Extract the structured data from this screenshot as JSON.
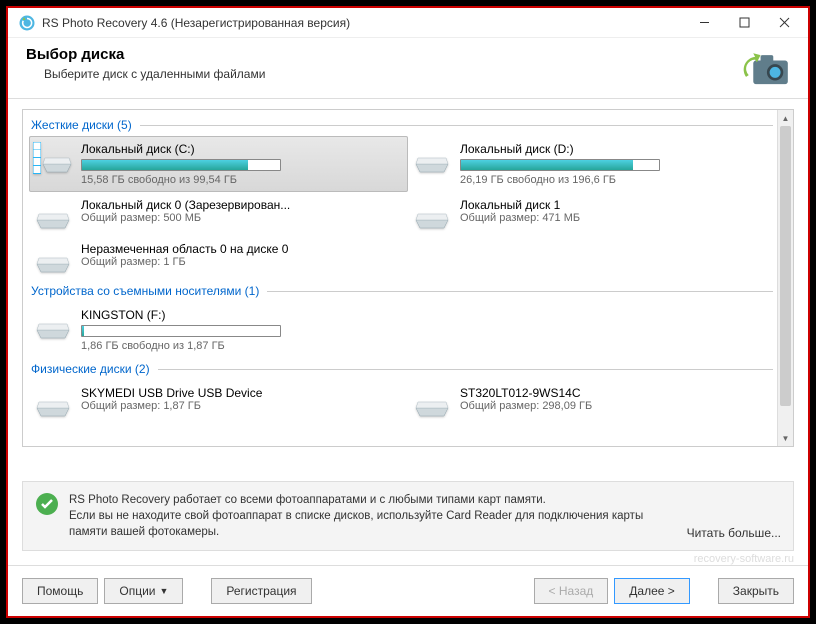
{
  "window": {
    "title": "RS Photo Recovery 4.6 (Незарегистрированная версия)"
  },
  "header": {
    "title": "Выбор диска",
    "subtitle": "Выберите диск с удаленными файлами"
  },
  "sections": {
    "hard": {
      "label": "Жесткие диски (5)"
    },
    "removable": {
      "label": "Устройства со съемными носителями (1)"
    },
    "physical": {
      "label": "Физические диски (2)"
    }
  },
  "disks": {
    "c": {
      "name": "Локальный диск (C:)",
      "sub": "15,58 ГБ свободно из 99,54 ГБ",
      "fill": 84
    },
    "d": {
      "name": "Локальный диск (D:)",
      "sub": "26,19 ГБ свободно из 196,6 ГБ",
      "fill": 87
    },
    "l0": {
      "name": "Локальный диск 0 (Зарезервирован...",
      "sub": "Общий размер: 500 МБ"
    },
    "l1": {
      "name": "Локальный диск 1",
      "sub": "Общий размер: 471 МБ"
    },
    "un": {
      "name": "Неразмеченная область 0 на диске 0",
      "sub": "Общий размер: 1 ГБ"
    },
    "k": {
      "name": "KINGSTON (F:)",
      "sub": "1,86 ГБ свободно из 1,87 ГБ",
      "fill": 1
    },
    "sky": {
      "name": "SKYMEDI USB Drive USB Device",
      "sub": "Общий размер: 1,87 ГБ"
    },
    "st": {
      "name": "ST320LT012-9WS14C",
      "sub": "Общий размер: 298,09 ГБ"
    }
  },
  "info": {
    "text": "RS Photo Recovery работает со всеми фотоаппаратами и с любыми типами карт памяти.\nЕсли вы не находите свой фотоаппарат в списке дисков, используйте Card Reader для подключения карты памяти вашей фотокамеры.",
    "link": "Читать больше..."
  },
  "watermark": "recovery-software.ru",
  "buttons": {
    "help": "Помощь",
    "options": "Опции",
    "register": "Регистрация",
    "back": "< Назад",
    "next": "Далее >",
    "close": "Закрыть"
  }
}
